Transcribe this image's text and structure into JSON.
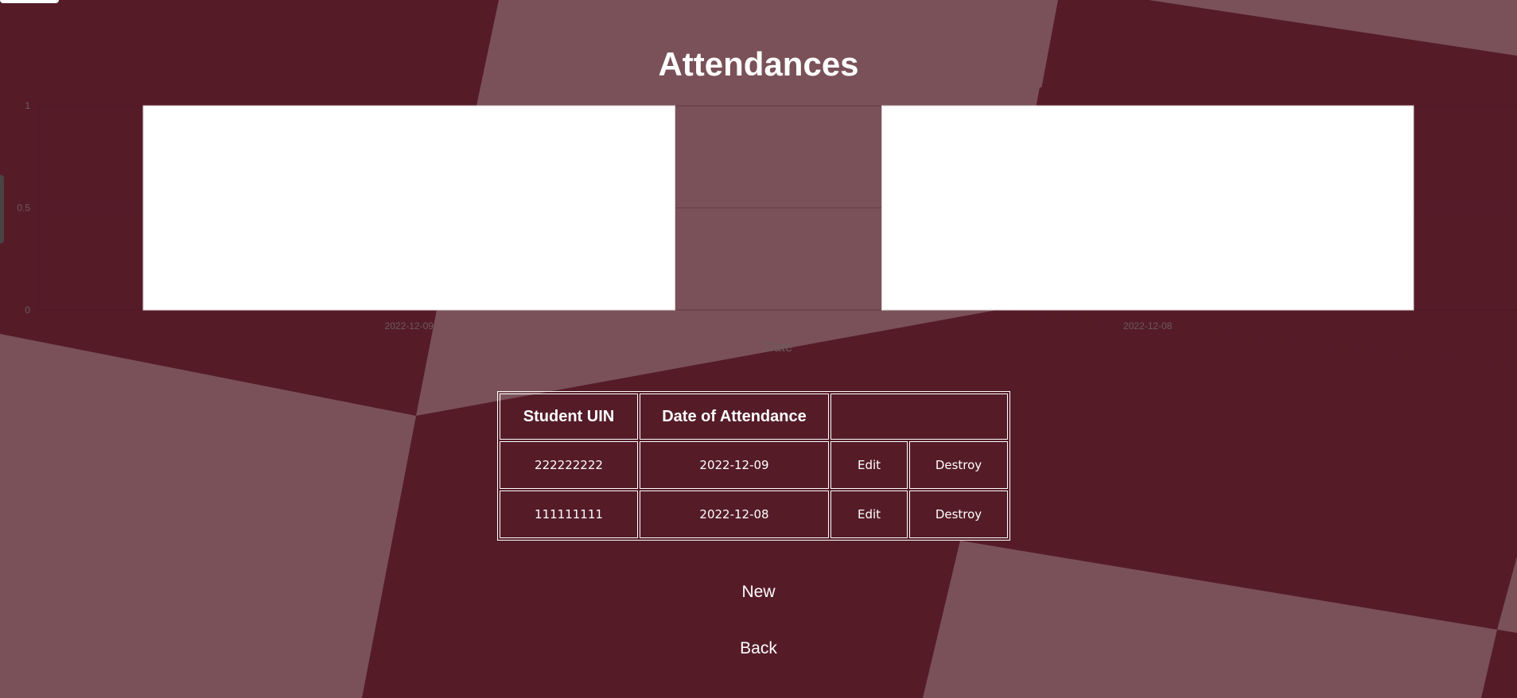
{
  "page": {
    "title": "Attendances"
  },
  "colors": {
    "background_dark": "#551c28",
    "background_light": "#7a5158",
    "bar_fill": "#ffffff",
    "axis_text": "#6b5a5d"
  },
  "chart_data": {
    "type": "bar",
    "categories": [
      "2022-12-09",
      "2022-12-08"
    ],
    "values": [
      1,
      1
    ],
    "xlabel": "Date",
    "ylabel": "",
    "ylim": [
      0,
      1
    ],
    "yticks": [
      "0",
      "0.5",
      "1"
    ],
    "grid": true,
    "legend": "none"
  },
  "table": {
    "headers": {
      "uin": "Student UIN",
      "date": "Date of Attendance",
      "actions": ""
    },
    "rows": [
      {
        "uin": "222222222",
        "date": "2022-12-09",
        "edit": "Edit",
        "destroy": "Destroy"
      },
      {
        "uin": "111111111",
        "date": "2022-12-08",
        "edit": "Edit",
        "destroy": "Destroy"
      }
    ]
  },
  "links": {
    "new": "New",
    "back": "Back"
  }
}
